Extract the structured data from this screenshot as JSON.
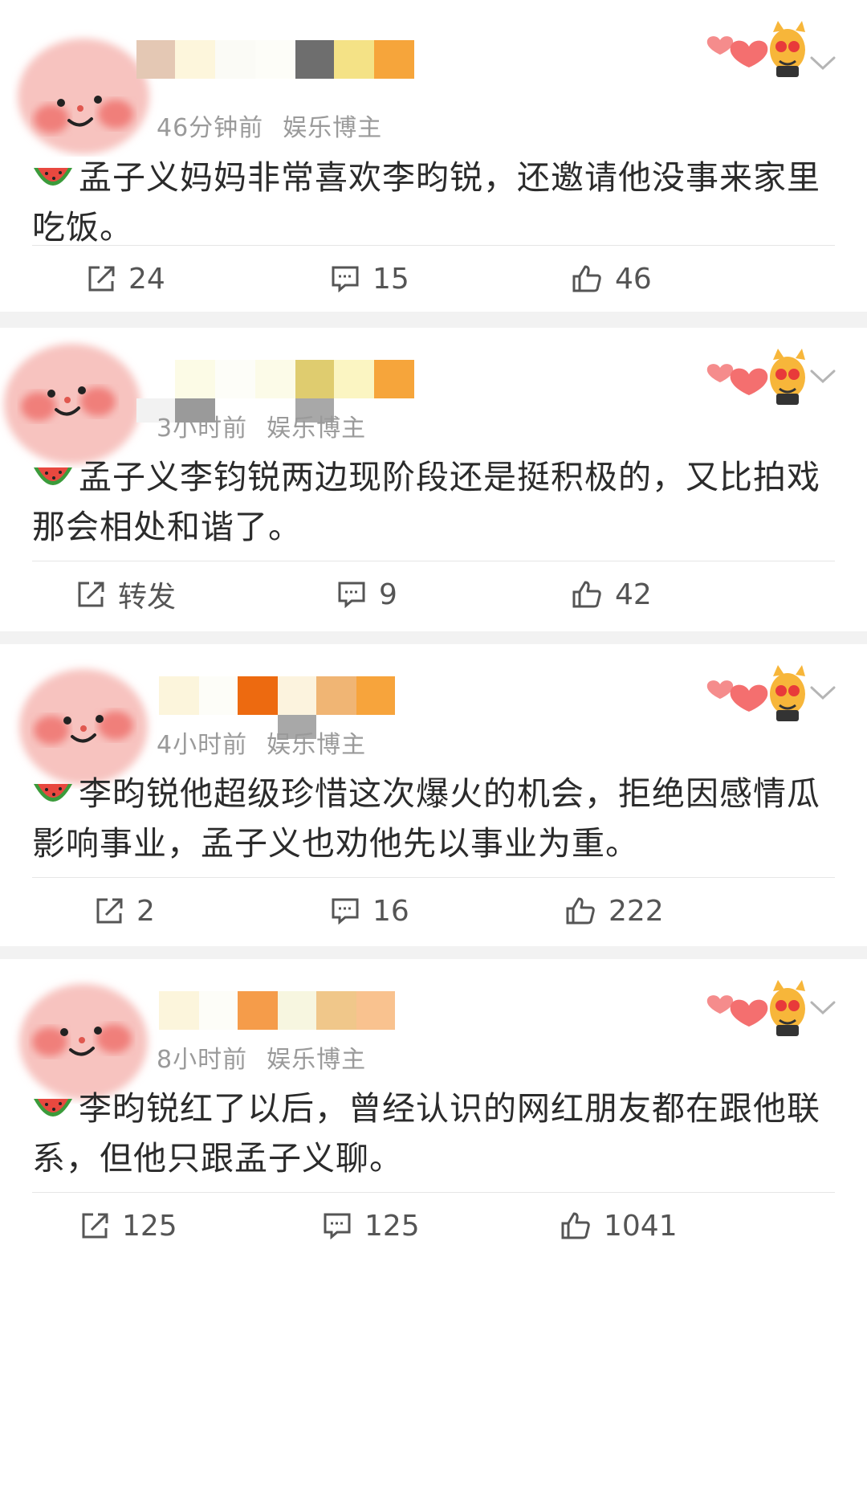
{
  "posts": [
    {
      "time": "46分钟前",
      "tag": "娱乐博主",
      "text": "孟子义妈妈非常喜欢李昀锐，还邀请他没事来家里吃饭。",
      "repost": "24",
      "comments": "15",
      "likes": "46"
    },
    {
      "time": "3小时前",
      "tag": "娱乐博主",
      "text": "孟子义李钧锐两边现阶段还是挺积极的，又比拍戏那会相处和谐了。",
      "repost": "转发",
      "comments": "9",
      "likes": "42"
    },
    {
      "time": "4小时前",
      "tag": "娱乐博主",
      "text": "李昀锐他超级珍惜这次爆火的机会，拒绝因感情瓜影响事业，孟子义也劝他先以事业为重。",
      "repost": "2",
      "comments": "16",
      "likes": "222"
    },
    {
      "time": "8小时前",
      "tag": "娱乐博主",
      "text": "李昀锐红了以后，曾经认识的网红朋友都在跟他联系，但他只跟孟子义聊。",
      "repost": "125",
      "comments": "125",
      "likes": "1041"
    }
  ],
  "icons": {
    "repost": "share-icon",
    "comment": "comment-icon",
    "like": "thumbs-up-icon",
    "emoji": "watermelon-icon",
    "avatar": "face-avatar",
    "badge": "heart-cat-sticker",
    "menu": "chevron-down-icon"
  },
  "colors": {
    "background": "#f2f2f2",
    "card": "#ffffff",
    "meta": "#9a9a9a",
    "text": "#2b2b2b"
  }
}
